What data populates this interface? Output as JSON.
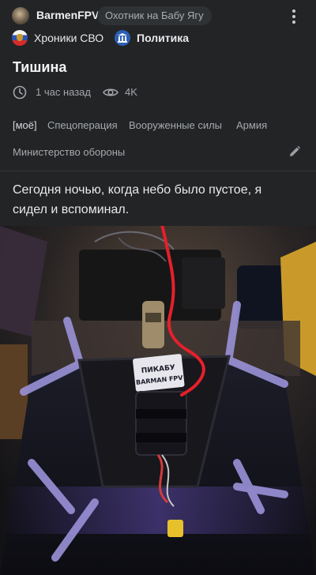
{
  "header": {
    "author": "BarmenFPV",
    "author_title": "Охотник на Бабу Ягу",
    "more_icon": "more-vertical-icon"
  },
  "communities": [
    {
      "label": "Хроники СВО",
      "icon": "russian-flag-icon"
    },
    {
      "label": "Политика",
      "icon": "government-building-icon"
    }
  ],
  "post": {
    "title": "Тишина",
    "time": "1 час назад",
    "views": "4K",
    "text": "Сегодня ночью, когда небо было пустое, я сидел и вспоминал."
  },
  "tags": [
    "[моё]",
    "Спецоперация",
    "Вооруженные силы",
    "Армия",
    "Министерство обороны"
  ],
  "photo": {
    "drone_label_line1": "ПИКАБУ",
    "drone_label_line2": "BARMAN FPV"
  },
  "colors": {
    "background": "#222426",
    "accent_blue": "#2c5fb6",
    "annotation_red": "#e5202b",
    "uv_light": "#8b6cff"
  }
}
